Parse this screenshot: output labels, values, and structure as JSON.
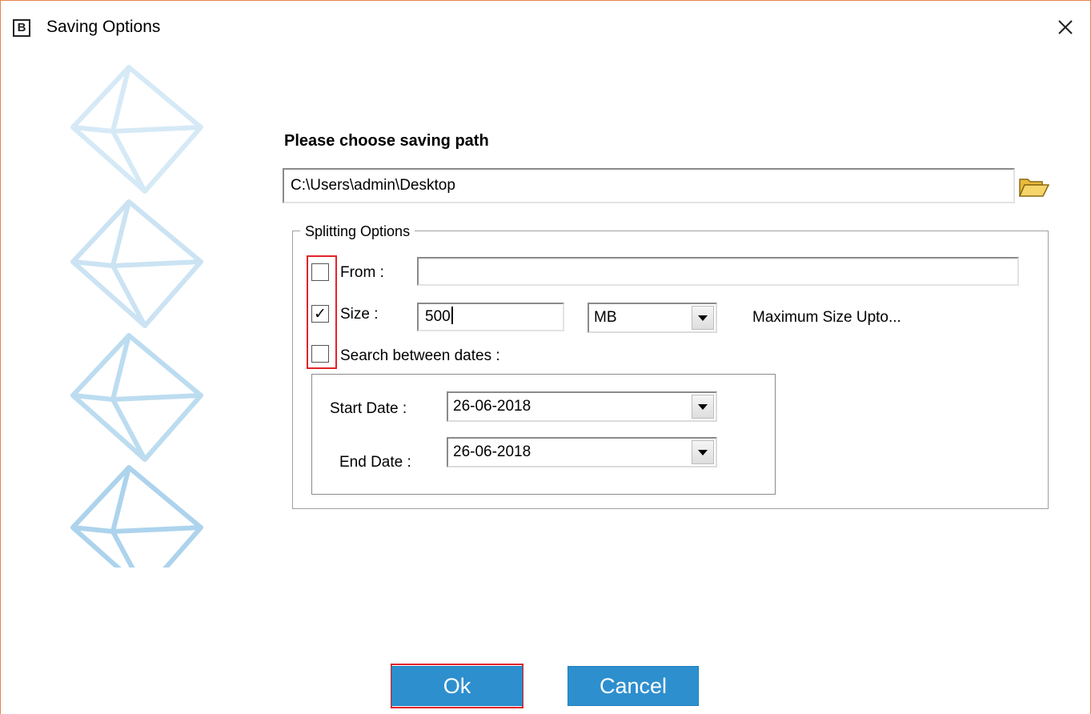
{
  "window": {
    "title": "Saving Options",
    "app_icon_letter": "B",
    "border_color": "#e8834a"
  },
  "icons": {
    "close": "close-icon",
    "folder": "folder-open-icon",
    "decoration": "envelope-icon",
    "combo_arrow": "chevron-down-icon",
    "check": "checkmark-icon"
  },
  "main": {
    "heading": "Please choose saving path",
    "path_value": "C:\\Users\\admin\\Desktop"
  },
  "splitting": {
    "legend": "Splitting Options",
    "from": {
      "label": "From :",
      "checked": false,
      "value": ""
    },
    "size": {
      "label": "Size :",
      "checked": true,
      "check_glyph": "✓",
      "value": "500",
      "unit": "MB",
      "hint": "Maximum Size Upto..."
    },
    "dates": {
      "label": "Search between dates :",
      "checked": false,
      "start_label": "Start Date :",
      "start_value": "26-06-2018",
      "end_label": "End Date :",
      "end_value": "26-06-2018"
    }
  },
  "buttons": {
    "ok": "Ok",
    "cancel": "Cancel",
    "color": "#2e8fce"
  },
  "highlight_color": "#e0242a"
}
